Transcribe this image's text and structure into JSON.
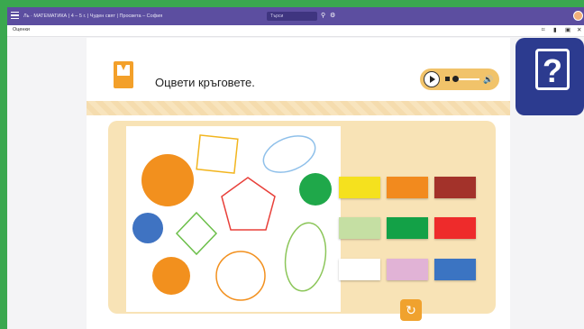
{
  "topbar": {
    "title": "Ль · МАТЕМАТИКА | 4 – 5 г. | Чуден свят | Просвета – София",
    "search_placeholder": "Търси",
    "bg_color": "#5c4ea0"
  },
  "subbar": {
    "label": "Оценки"
  },
  "task": {
    "instruction": "Оцвети кръговете."
  },
  "audio": {
    "play_icon": "play-icon",
    "stop_icon": "stop-icon",
    "volume_icon": "volume-icon"
  },
  "shapes": [
    {
      "type": "circle",
      "fill": "#f2901e",
      "stroke": "none"
    },
    {
      "type": "square",
      "fill": "none",
      "stroke": "#f2b51e"
    },
    {
      "type": "ellipse",
      "fill": "none",
      "stroke": "#8fc0ea"
    },
    {
      "type": "circle",
      "fill": "#1fa84a",
      "stroke": "none"
    },
    {
      "type": "pentagon",
      "fill": "none",
      "stroke": "#e8403a"
    },
    {
      "type": "circle",
      "fill": "#3f73c2",
      "stroke": "none"
    },
    {
      "type": "diamond",
      "fill": "none",
      "stroke": "#6cbf4a"
    },
    {
      "type": "ellipse",
      "fill": "none",
      "stroke": "#8cc65a"
    },
    {
      "type": "circle",
      "fill": "#f2901e",
      "stroke": "none"
    },
    {
      "type": "circle",
      "fill": "none",
      "stroke": "#f2901e"
    }
  ],
  "palette": [
    {
      "name": "yellow",
      "color": "#f5e11e"
    },
    {
      "name": "orange",
      "color": "#f28a1e"
    },
    {
      "name": "brown",
      "color": "#a3322a"
    },
    {
      "name": "light-green",
      "color": "#c5dfa3"
    },
    {
      "name": "green",
      "color": "#13a147"
    },
    {
      "name": "red",
      "color": "#ee2b2b"
    },
    {
      "name": "white",
      "color": "#ffffff"
    },
    {
      "name": "pink",
      "color": "#e1b3d6"
    },
    {
      "name": "blue",
      "color": "#3b74c2"
    }
  ],
  "help": {
    "icon": "question-icon",
    "color": "#2c3b8f"
  },
  "colors": {
    "accent": "#f0a22e",
    "frame": "#3aa84f"
  }
}
